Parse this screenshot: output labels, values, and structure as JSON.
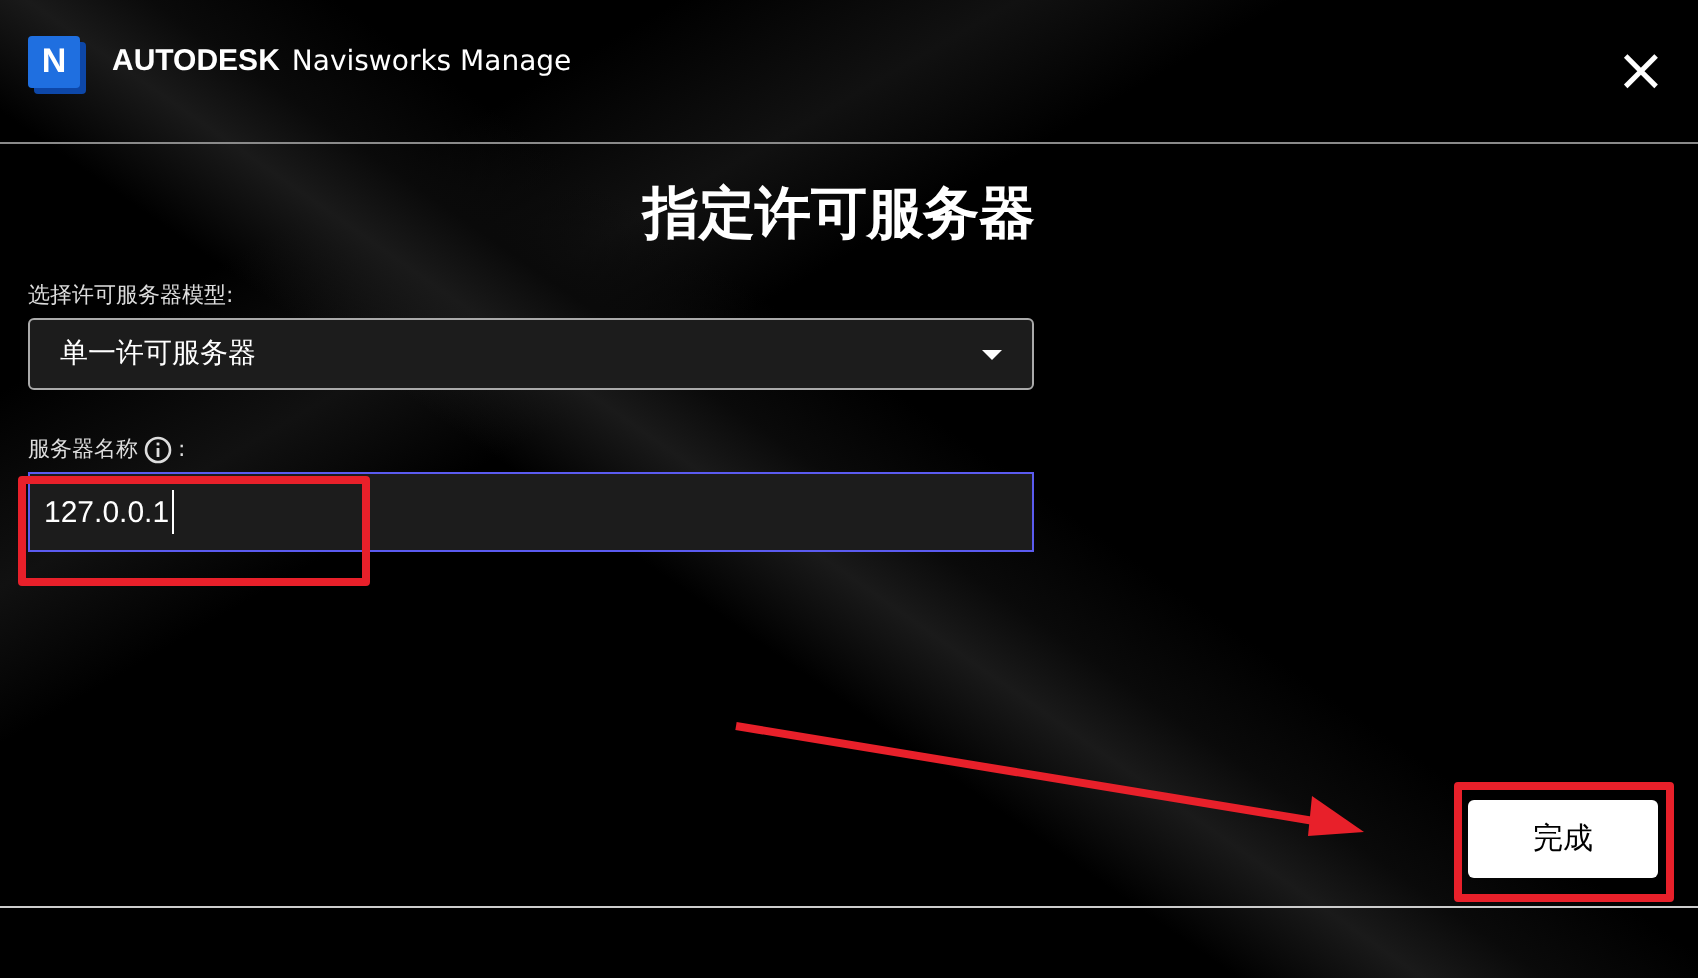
{
  "header": {
    "brand": "AUTODESK",
    "product": "Navisworks Manage",
    "logo_letter": "N",
    "close": "×"
  },
  "title": "指定许可服务器",
  "model_field": {
    "label": "选择许可服务器模型:",
    "value": "单一许可服务器"
  },
  "name_field": {
    "label": "服务器名称",
    "suffix": ":",
    "value": "127.0.0.1",
    "focused": true
  },
  "buttons": [
    {
      "label": "完成"
    }
  ],
  "annotations": [
    {
      "kind": "field-box"
    },
    {
      "kind": "arrow"
    },
    {
      "kind": "button-box"
    }
  ]
}
